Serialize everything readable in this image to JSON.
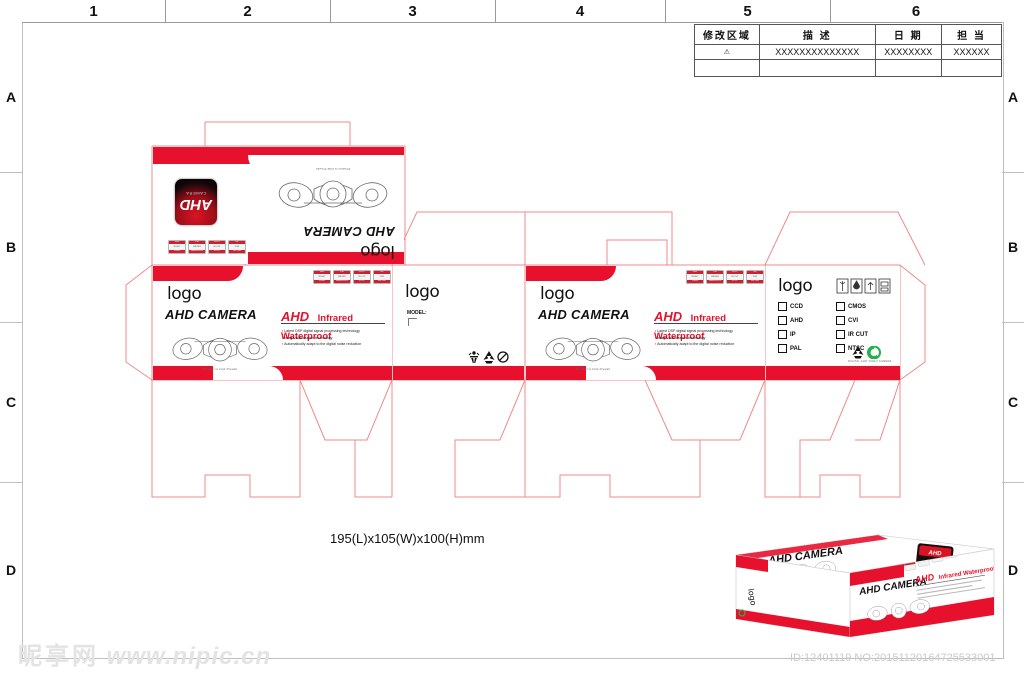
{
  "sheet": {
    "columns": [
      "1",
      "2",
      "3",
      "4",
      "5",
      "6"
    ],
    "rows": [
      "A",
      "B",
      "C",
      "D"
    ],
    "rows_right": [
      "A",
      "B",
      "C",
      "D"
    ]
  },
  "revision_table": {
    "headers": [
      "修改区域",
      "描 述",
      "日 期",
      "担 当"
    ],
    "rows": [
      {
        "area": "⚠",
        "description": "XXXXXXXXXXXXXX",
        "date": "XXXXXXXX",
        "owner": "XXXXXX"
      }
    ]
  },
  "top_flap": {
    "logo_text": "logo",
    "title": "AHD CAMERA",
    "illustration_caption": "Product is kind Prevail",
    "square_logo": {
      "title": "AHD",
      "subtitle": "CAMERA"
    },
    "feature_badges": [
      {
        "top": "1080P",
        "label": "NIGHT",
        "bottom": "VISION"
      },
      {
        "top": "IP66",
        "label": "WATER",
        "bottom": "WATERPROOF"
      },
      {
        "top": "IR-CUT",
        "label": "IR CUT",
        "bottom": "IR CUT"
      },
      {
        "top": "DSP",
        "label": "DSP",
        "bottom": "DSP CHIP"
      }
    ]
  },
  "front_panel": {
    "logo_text": "logo",
    "model_line": "AHD CAMERA",
    "headline_ahd": "AHD",
    "headline_rest": "Infrared Waterproof",
    "bullets": [
      "Latest DSP digital signal processing technology",
      "Image stabilization technology",
      "Automatically adapt to the digital noise reduction"
    ],
    "illustration_caption": "Product is kind Prevail",
    "feature_badges": [
      {
        "top": "1080P",
        "label": "NIGHT",
        "bottom": "VISION"
      },
      {
        "top": "IP66",
        "label": "WATER",
        "bottom": "WATERPROOF"
      },
      {
        "top": "IR-CUT",
        "label": "IR CUT",
        "bottom": "IR CUT"
      },
      {
        "top": "DSP",
        "label": "DSP",
        "bottom": "DSP CHIP"
      }
    ]
  },
  "side_panel": {
    "logo_text": "logo",
    "model_label": "MODEL:",
    "icons": [
      "handling-icon",
      "recycle-icon",
      "no-littering-icon"
    ]
  },
  "spec_panel": {
    "logo_text": "logo",
    "handling_icons": [
      "fragile-icon",
      "keep-dry-icon",
      "this-side-up-icon",
      "no-stack-icon"
    ],
    "options_left": [
      "CCD",
      "AHD",
      "IP",
      "PAL"
    ],
    "options_right": [
      "CMOS",
      "CVI",
      "IR CUT",
      "NTSC"
    ],
    "footer_caption": "DIGITAL AHD VIDEO CAMERA"
  },
  "dimension_text": "195(L)x105(W)x100(H)mm",
  "mockup": {
    "top_title": "AHD CAMERA",
    "front_title": "AHD CAMERA",
    "headline_ahd": "AHD",
    "headline_rest": "Infrared Waterproof",
    "side_logo": "logo"
  },
  "watermark": {
    "cjk": "昵享网",
    "url": "www.nipic.cn"
  },
  "id_text": "ID:12401119 NO:20151120164725533001",
  "colors": {
    "brand_red": "#e8112d",
    "dieline_red": "#f08a8a",
    "frame_gray": "#bfbfbf"
  }
}
